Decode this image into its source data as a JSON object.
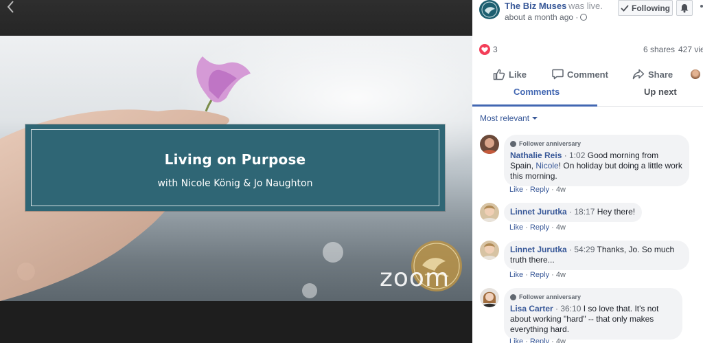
{
  "video": {
    "banner_title": "Living on Purpose",
    "banner_subtitle": "with Nicole König & Jo Naughton",
    "watermark": "zoom"
  },
  "post": {
    "page_name": "The Biz Muses",
    "status": "was live.",
    "timestamp": "about a month ago ·",
    "following_label": "Following",
    "reaction_count": "3",
    "shares": "6 shares",
    "views": "427 vie"
  },
  "actions": {
    "like": "Like",
    "comment": "Comment",
    "share": "Share"
  },
  "tabs": {
    "comments": "Comments",
    "up_next": "Up next"
  },
  "sort": {
    "label": "Most relevant"
  },
  "comments": [
    {
      "badge": "Follower anniversary",
      "author": "Nathalie Reis",
      "time": "· 1:02",
      "text_before": " Good morning from Spain, ",
      "mention": "Nicole",
      "text_after": "! On holiday but doing a little work this morning.",
      "like": "Like",
      "reply": "Reply",
      "age": "4w"
    },
    {
      "author": "Linnet Jurutka",
      "time": "· 18:17",
      "text": " Hey there!",
      "like": "Like",
      "reply": "Reply",
      "age": "4w"
    },
    {
      "author": "Linnet Jurutka",
      "time": "· 54:29",
      "text": " Thanks, Jo. So much truth there...",
      "like": "Like",
      "reply": "Reply",
      "age": "4w"
    },
    {
      "badge": "Follower anniversary",
      "author": "Lisa Carter",
      "time": "· 36:10",
      "text": " I so love that. It's not about working \"hard\" -- that only makes everything hard.",
      "like": "Like",
      "reply": "Reply",
      "age": "4w"
    }
  ],
  "colors": {
    "link_blue": "#385898",
    "tab_blue": "#4267b2",
    "banner_teal": "#2f6675",
    "heart_red": "#f33e58"
  }
}
